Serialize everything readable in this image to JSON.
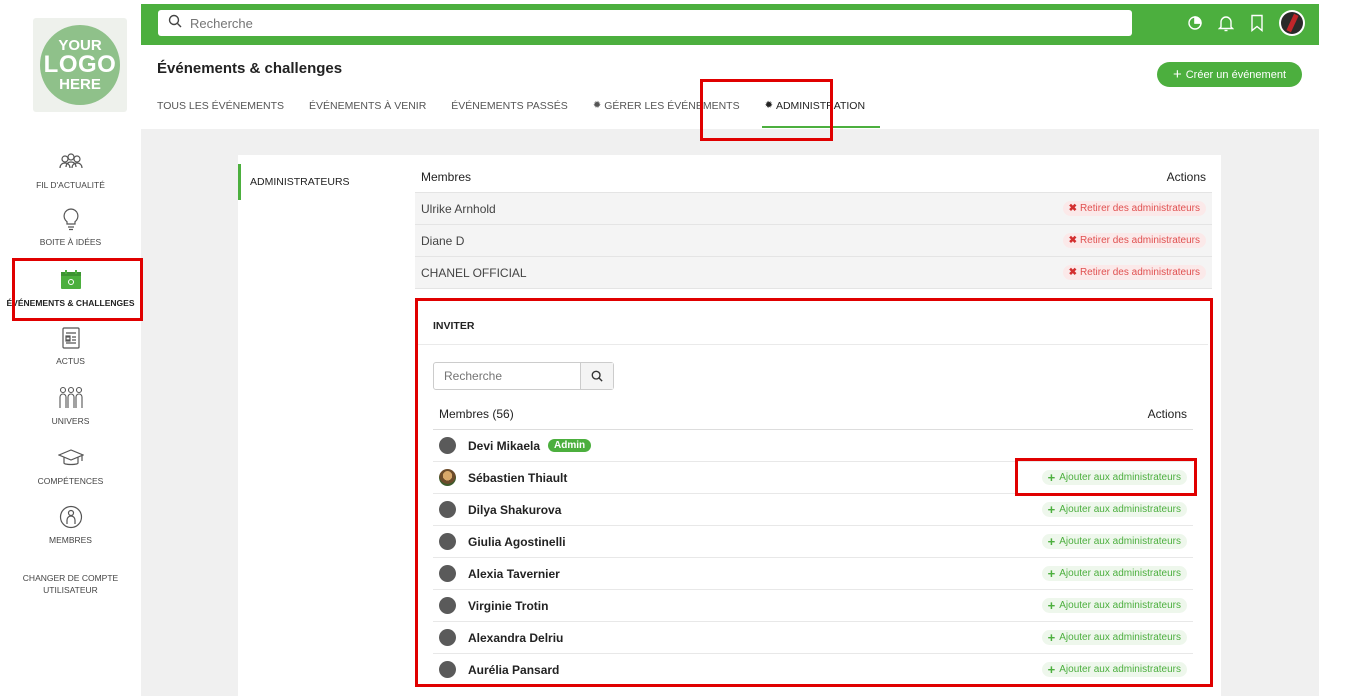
{
  "sidebar": {
    "logo": {
      "line1": "YOUR",
      "line2": "LOGO",
      "line3": "HERE"
    },
    "items": [
      {
        "label": "FIL D'ACTUALITÉ",
        "icon": "people-group-icon"
      },
      {
        "label": "BOITE À IDÉES",
        "icon": "lightbulb-icon"
      },
      {
        "label": "ÉVÉNEMENTS & CHALLENGES",
        "icon": "calendar-icon"
      },
      {
        "label": "ACTUS",
        "icon": "newspaper-icon"
      },
      {
        "label": "UNIVERS",
        "icon": "community-icon"
      },
      {
        "label": "COMPÉTENCES",
        "icon": "graduation-cap-icon"
      },
      {
        "label": "MEMBRES",
        "icon": "member-icon"
      },
      {
        "label": "CHANGER DE COMPTE UTILISATEUR"
      }
    ]
  },
  "topbar": {
    "search_placeholder": "Recherche",
    "icons": [
      "pie-chart-icon",
      "bell-icon",
      "bookmark-icon",
      "user-avatar-icon"
    ]
  },
  "header": {
    "title": "Événements & challenges",
    "create_button": "Créer un événement",
    "tabs": [
      {
        "label": "TOUS LES ÉVÉNEMENTS"
      },
      {
        "label": "ÉVÉNEMENTS À VENIR"
      },
      {
        "label": "ÉVÉNEMENTS PASSÉS"
      },
      {
        "label": "GÉRER LES ÉVÉNEMENTS"
      },
      {
        "label": "ADMINISTRATION"
      }
    ]
  },
  "panel": {
    "nav_label": "ADMINISTRATEURS",
    "admins": {
      "col_members": "Membres",
      "col_actions": "Actions",
      "rows": [
        {
          "name": "Ulrike Arnhold",
          "action": "Retirer des administrateurs"
        },
        {
          "name": "Diane D",
          "action": "Retirer des administrateurs"
        },
        {
          "name": "CHANEL OFFICIAL",
          "action": "Retirer des administrateurs"
        }
      ]
    },
    "invite": {
      "title": "INVITER",
      "search_placeholder": "Recherche",
      "col_members": "Membres (56)",
      "col_actions": "Actions",
      "admin_badge": "Admin",
      "members": [
        {
          "name": "Devi Mikaela",
          "is_admin": true
        },
        {
          "name": "Sébastien Thiault",
          "action": "Ajouter aux administrateurs"
        },
        {
          "name": "Dilya Shakurova",
          "action": "Ajouter aux administrateurs"
        },
        {
          "name": "Giulia Agostinelli",
          "action": "Ajouter aux administrateurs"
        },
        {
          "name": "Alexia Tavernier",
          "action": "Ajouter aux administrateurs"
        },
        {
          "name": "Virginie Trotin",
          "action": "Ajouter aux administrateurs"
        },
        {
          "name": "Alexandra Delriu",
          "action": "Ajouter aux administrateurs"
        },
        {
          "name": "Aurélia Pansard",
          "action": "Ajouter aux administrateurs"
        }
      ]
    }
  },
  "colors": {
    "accent": "#4caf3e",
    "highlight": "#e00000",
    "danger": "#e05050"
  }
}
